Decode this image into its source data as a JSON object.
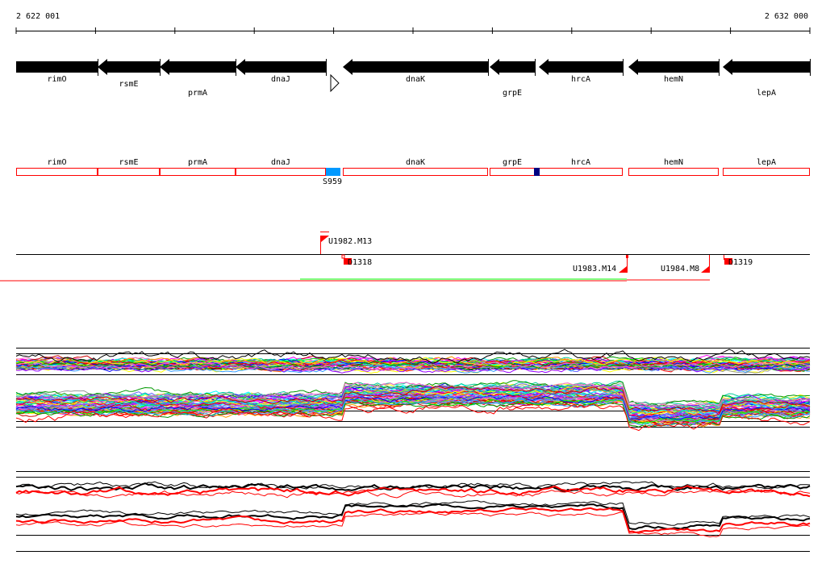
{
  "ruler": {
    "start_label": "2 622 001",
    "end_label": "2 632 000"
  },
  "genes": [
    {
      "name": "rimO"
    },
    {
      "name": "rsmE"
    },
    {
      "name": "prmA"
    },
    {
      "name": "dnaJ"
    },
    {
      "name": "dnaK"
    },
    {
      "name": "grpE"
    },
    {
      "name": "hrcA"
    },
    {
      "name": "hemN"
    },
    {
      "name": "lepA"
    }
  ],
  "features": {
    "s959": "S959"
  },
  "markers": {
    "u1982": "U1982.M13",
    "d1318": "D1318",
    "u1983": "U1983.M14",
    "u1984": "U1984.M8",
    "d1319": "D1319"
  },
  "colors": {
    "gene": "#000000",
    "box": "#ff0000",
    "s959": "#0099ff",
    "navy": "#000080",
    "green": "#00ff00",
    "red": "#ff0000"
  }
}
